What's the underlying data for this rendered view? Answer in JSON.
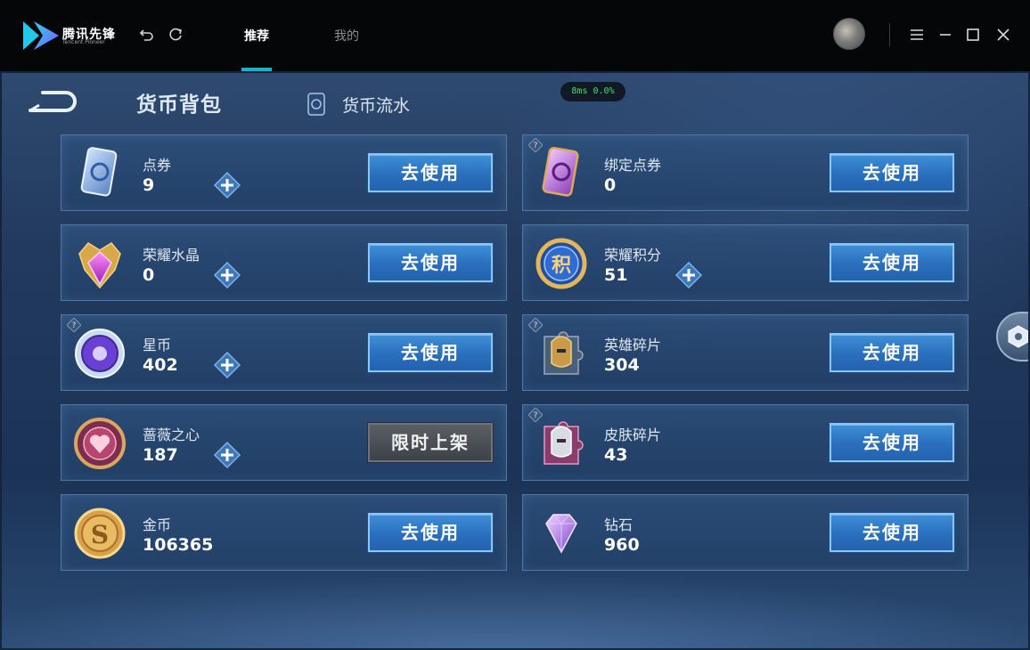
{
  "app": {
    "title": "腾讯先锋",
    "subtitle": "Tencent Pioneer"
  },
  "tabs": [
    {
      "label": "推荐",
      "active": true
    },
    {
      "label": "我的",
      "active": false
    }
  ],
  "game": {
    "page_title": "货币背包",
    "flow_link": "货币流水",
    "ping": "8ms  0.0%",
    "colors": {
      "button": "#2a6fbd",
      "button_border": "#8cc6f5",
      "ping_text": "#46e06a",
      "tab_accent": "#19b3c8"
    }
  },
  "currencies": [
    {
      "name": "点券",
      "value": "9",
      "button": "去使用",
      "button_enabled": true,
      "has_plus": true,
      "has_help": false,
      "icon": "coupon-card-icon"
    },
    {
      "name": "绑定点券",
      "value": "0",
      "button": "去使用",
      "button_enabled": true,
      "has_plus": false,
      "has_help": true,
      "icon": "bound-coupon-card-icon"
    },
    {
      "name": "荣耀水晶",
      "value": "0",
      "button": "去使用",
      "button_enabled": true,
      "has_plus": true,
      "has_help": false,
      "icon": "glory-crystal-icon"
    },
    {
      "name": "荣耀积分",
      "value": "51",
      "button": "去使用",
      "button_enabled": true,
      "has_plus": true,
      "has_help": false,
      "icon": "glory-points-icon"
    },
    {
      "name": "星币",
      "value": "402",
      "button": "去使用",
      "button_enabled": true,
      "has_plus": true,
      "has_help": true,
      "icon": "star-coin-icon"
    },
    {
      "name": "英雄碎片",
      "value": "304",
      "button": "去使用",
      "button_enabled": true,
      "has_plus": false,
      "has_help": true,
      "icon": "hero-fragment-icon"
    },
    {
      "name": "蔷薇之心",
      "value": "187",
      "button": "限时上架",
      "button_enabled": false,
      "has_plus": true,
      "has_help": false,
      "icon": "rose-heart-icon"
    },
    {
      "name": "皮肤碎片",
      "value": "43",
      "button": "去使用",
      "button_enabled": true,
      "has_plus": false,
      "has_help": true,
      "icon": "skin-fragment-icon"
    },
    {
      "name": "金币",
      "value": "106365",
      "button": "去使用",
      "button_enabled": true,
      "has_plus": false,
      "has_help": false,
      "icon": "gold-coin-icon"
    },
    {
      "name": "钻石",
      "value": "960",
      "button": "去使用",
      "button_enabled": true,
      "has_plus": false,
      "has_help": false,
      "icon": "diamond-icon"
    }
  ]
}
